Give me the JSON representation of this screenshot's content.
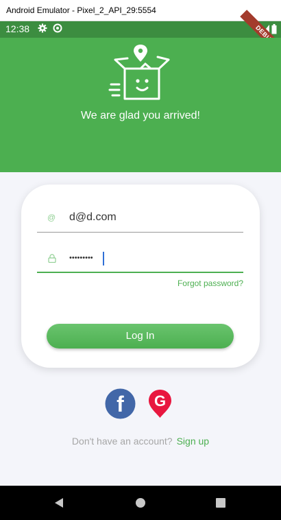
{
  "window": {
    "title": "Android Emulator - Pixel_2_API_29:5554"
  },
  "status_bar": {
    "time": "12:38",
    "debug_banner": "DEBUG"
  },
  "header": {
    "welcome_text": "We are glad you arrived!"
  },
  "login_form": {
    "email_icon": "@",
    "email_value": "d@d.com",
    "password_value": "•••••••••",
    "forgot_password_label": "Forgot password?",
    "login_button_label": "Log In"
  },
  "social": {
    "facebook_letter": "f",
    "google_letter": "G"
  },
  "signup": {
    "prompt": "Don't have an account?",
    "link_label": "Sign up"
  },
  "colors": {
    "primary": "#4caf50",
    "status_bar": "#3c8d40",
    "facebook": "#4267a8",
    "google": "#e8173f",
    "background": "#f4f5fa"
  }
}
